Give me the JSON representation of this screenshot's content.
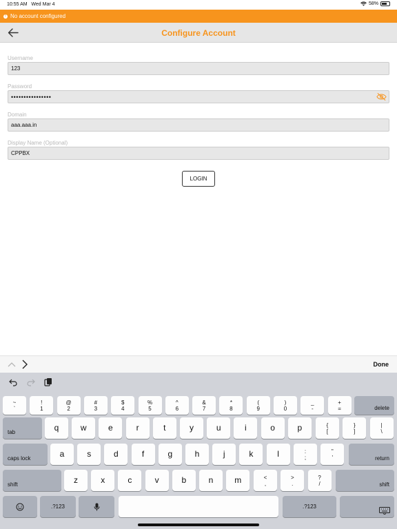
{
  "status": {
    "time": "10:55 AM",
    "date": "Wed Mar 4",
    "battery": "58%"
  },
  "banner": {
    "text": "No account configured"
  },
  "nav": {
    "title": "Configure Account"
  },
  "form": {
    "username_label": "Username",
    "username_value": "123",
    "password_label": "Password",
    "password_value": "••••••••••••••••",
    "domain_label": "Domain",
    "domain_value": "aaa.aaa.in",
    "display_label": "Display Name (Optional)",
    "display_value": "CPPBX"
  },
  "login_label": "LOGIN",
  "accessory": {
    "done": "Done"
  },
  "keyboard": {
    "row1": [
      {
        "top": "~",
        "bot": "`"
      },
      {
        "top": "!",
        "bot": "1"
      },
      {
        "top": "@",
        "bot": "2"
      },
      {
        "top": "#",
        "bot": "3"
      },
      {
        "top": "$",
        "bot": "4"
      },
      {
        "top": "%",
        "bot": "5"
      },
      {
        "top": "^",
        "bot": "6"
      },
      {
        "top": "&",
        "bot": "7"
      },
      {
        "top": "*",
        "bot": "8"
      },
      {
        "top": "(",
        "bot": "9"
      },
      {
        "top": ")",
        "bot": "0"
      },
      {
        "top": "_",
        "bot": "-"
      },
      {
        "top": "+",
        "bot": "="
      }
    ],
    "delete": "delete",
    "tab": "tab",
    "row2": [
      "q",
      "w",
      "e",
      "r",
      "t",
      "y",
      "u",
      "i",
      "o",
      "p"
    ],
    "row2_sym": [
      {
        "top": "{",
        "bot": "["
      },
      {
        "top": "}",
        "bot": "]"
      },
      {
        "top": "|",
        "bot": "\\"
      }
    ],
    "caps": "caps lock",
    "row3": [
      "a",
      "s",
      "d",
      "f",
      "g",
      "h",
      "j",
      "k",
      "l"
    ],
    "row3_sym": [
      {
        "top": ":",
        "bot": ";"
      },
      {
        "top": "\"",
        "bot": "'"
      }
    ],
    "return": "return",
    "shift": "shift",
    "row4": [
      "z",
      "x",
      "c",
      "v",
      "b",
      "n",
      "m"
    ],
    "row4_sym": [
      {
        "top": "<",
        "bot": ","
      },
      {
        "top": ">",
        "bot": "."
      },
      {
        "top": "?",
        "bot": "/"
      }
    ],
    "numbers": ".?123"
  }
}
